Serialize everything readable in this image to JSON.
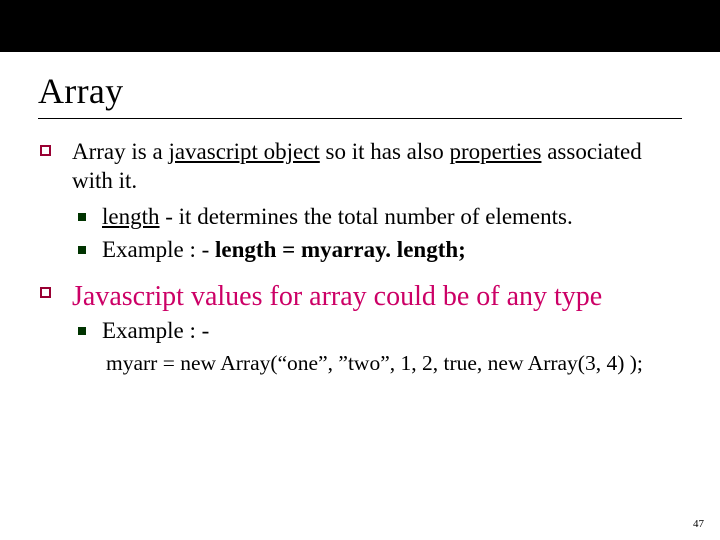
{
  "title": "Array",
  "items": [
    {
      "pre": "Array is a ",
      "u1": "javascript object",
      "mid": " so it has also ",
      "u2": "properties",
      "post": " associated with it.",
      "subs": [
        {
          "u": "length",
          "rest": " - it determines the total number of elements."
        },
        {
          "pre": "Example : - ",
          "bold": "length = myarray. length;"
        }
      ]
    },
    {
      "pink": "Javascript values for array could be of any type",
      "subs2": [
        {
          "text": "Example : -"
        }
      ],
      "code": "myarr = new Array(“one”, ”two”, 1, 2, true, new Array(3, 4) );"
    }
  ],
  "pageNumber": "47"
}
